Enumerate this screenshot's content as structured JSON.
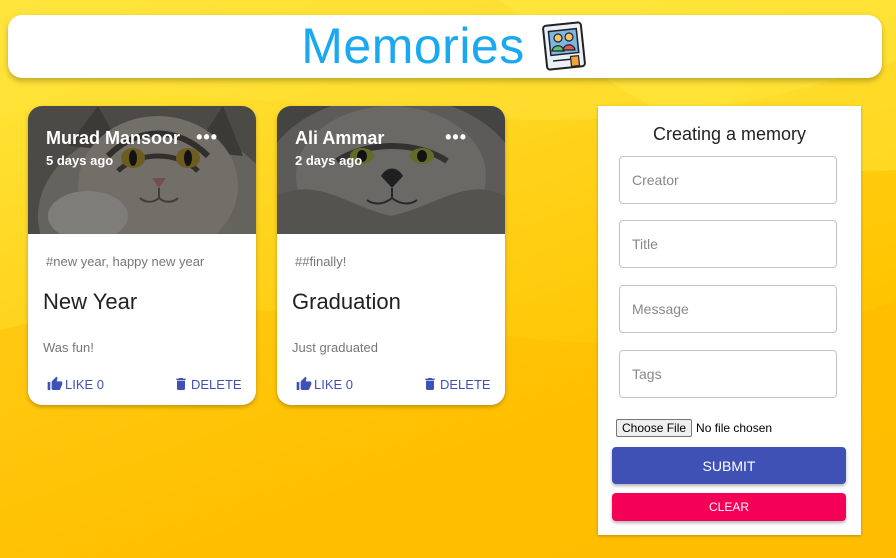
{
  "app": {
    "title": "Memories",
    "logo_icon": "memories-photo-icon",
    "brand_color": "#1aa8f0"
  },
  "posts": [
    {
      "creator": "Murad Mansoor",
      "time": "5 days ago",
      "more_label": "•••",
      "tags": "#new year, happy new year",
      "title": "New Year",
      "message": "Was fun!",
      "like_label": "LIKE 0",
      "delete_label": "DELETE"
    },
    {
      "creator": "Ali Ammar",
      "time": "2 days ago",
      "more_label": "•••",
      "tags": "##finally!",
      "title": "Graduation",
      "message": "Just graduated",
      "like_label": "LIKE 0",
      "delete_label": "DELETE"
    }
  ],
  "form": {
    "title": "Creating a memory",
    "creator": {
      "placeholder": "Creator",
      "value": ""
    },
    "title_field": {
      "placeholder": "Title",
      "value": ""
    },
    "message": {
      "placeholder": "Message",
      "value": ""
    },
    "tags": {
      "placeholder": "Tags",
      "value": ""
    },
    "file_button": "Choose File",
    "file_status": "No file chosen",
    "submit_label": "SUBMIT",
    "clear_label": "CLEAR"
  },
  "colors": {
    "primary": "#3f51b5",
    "secondary": "#f50057",
    "background": "#ffc400"
  }
}
